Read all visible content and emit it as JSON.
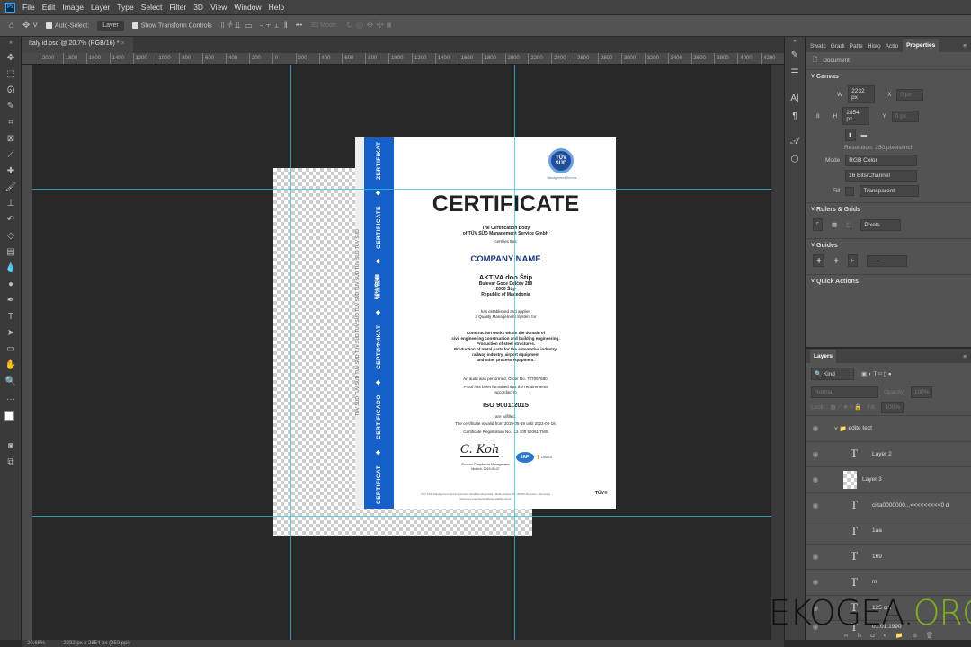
{
  "menu": {
    "logo": "Ps",
    "items": [
      "File",
      "Edit",
      "Image",
      "Layer",
      "Type",
      "Select",
      "Filter",
      "3D",
      "View",
      "Window",
      "Help"
    ]
  },
  "options": {
    "auto_select": "Auto-Select:",
    "layer_select": "Layer",
    "show_transform": "Show Transform Controls",
    "more": "•••",
    "mode_3d": "3D Mode:"
  },
  "doc_tab": {
    "title": "Italy id.psd @ 20.7% (RGB/16) *",
    "close": "×"
  },
  "ruler": [
    "2000",
    "1800",
    "1600",
    "1400",
    "1200",
    "1000",
    "800",
    "600",
    "400",
    "200",
    "0",
    "200",
    "400",
    "600",
    "800",
    "1000",
    "1200",
    "1400",
    "1600",
    "1800",
    "2000",
    "2200",
    "2400",
    "2600",
    "2800",
    "3000",
    "3200",
    "3400",
    "3600",
    "3800",
    "4000",
    "4200"
  ],
  "certificate": {
    "strip": [
      "CERTIFICAT",
      "◆",
      "CERTIFICADO",
      "◆",
      "СЕРТИФИКАТ",
      "◆",
      "認証證書",
      "◆",
      "CERTIFICATE",
      "◆",
      "ZERTIFIKAT"
    ],
    "edge": "TÜV SÜD  TÜV SÜD  TÜV SÜD  TÜV SÜD  TÜV SÜD  TÜV SÜD  TÜV SÜD  TÜV SÜD  TÜV SÜD",
    "logo": "TÜV SÜD",
    "logo_sub": "Management Service",
    "title": "CERTIFICATE",
    "body1": "The Certification Body",
    "body2": "of TÜV SÜD Management Service GmbH",
    "certifies": "certifies that",
    "company_name": "COMPANY NAME",
    "company": "AKTIVA doo Štip",
    "addr1": "Bulevar Goce Delčev 289",
    "addr2": "2000 Štip",
    "addr3": "Republic of Macedonia",
    "est1": "has established and applies",
    "est2": "a Quality Management System for",
    "scope": [
      "Construction works within the domain of",
      "civil engineering construction and building engineering.",
      "Production of steel structures.",
      "Production of metal parts for the automotive industry,",
      "railway industry, airport equipment",
      "and other process equipment."
    ],
    "audit": "An audit was performed, Order No. 707057680.",
    "proof1": "Proof has been furnished that the requirements",
    "proof2": "according to",
    "standard": "ISO 9001:2015",
    "fulfilled": "are fulfilled.",
    "valid": "The certificate is valid from 2019-05-19 until 2022-05-18.",
    "reg": "Certificate Registration No.: 12 100 52061 TMS",
    "signature": "C. Koh",
    "sig1": "Product Compliance Management",
    "sig2": "Munich, 2019-05-07",
    "iaf": "IAF",
    "dakks": "DAkkS",
    "footer1": "TÜV SÜD Management Service GmbH • Zertifizierungsstelle • Ridlerstrasse 65 • 80339 München • Germany",
    "footer2": "www.tuev-sued.de/certificate-validity-check",
    "footer_logo": "TÜV®"
  },
  "right_icons": [
    "brush-settings",
    "adjust",
    "character",
    "paragraph",
    "glyphs",
    "3d"
  ],
  "properties": {
    "tabs": [
      "Swatc",
      "Gradi",
      "Patte",
      "Histo",
      "Actio",
      "Properties"
    ],
    "document": "Document",
    "canvas": "Canvas",
    "w_label": "W",
    "w": "2232 px",
    "h_label": "H",
    "h": "2854 px",
    "x_label": "X",
    "x": "0 px",
    "y_label": "Y",
    "y": "0 px",
    "resolution": "Resolution: 250 pixels/inch",
    "mode_label": "Mode",
    "mode": "RGB Color",
    "depth": "16 Bits/Channel",
    "fill_label": "Fill",
    "fill": "Transparent",
    "rulers": "Rulers & Grids",
    "units": "Pixels",
    "guides": "Guides",
    "quick": "Quick Actions"
  },
  "layers": {
    "tab": "Layers",
    "kind": "Kind",
    "blend": "Normal",
    "opacity_label": "Opacity:",
    "opacity": "100%",
    "lock": "Lock:",
    "fill_label": "Fill:",
    "fill": "100%",
    "items": [
      {
        "name": "edite text",
        "type": "group"
      },
      {
        "name": "Layer 2",
        "type": "text"
      },
      {
        "name": "Layer 3",
        "type": "image"
      },
      {
        "name": "cilta0000000...<<<<<<<<<0 d",
        "type": "text"
      },
      {
        "name": "1aa",
        "type": "text",
        "hidden": true
      },
      {
        "name": "169",
        "type": "text"
      },
      {
        "name": "m",
        "type": "text"
      },
      {
        "name": "125 cm",
        "type": "text"
      },
      {
        "name": "01.01.1990",
        "type": "text"
      }
    ]
  },
  "status": {
    "zoom": "20.66%",
    "size": "2232 px x 2854 px (250 ppi)"
  },
  "watermark": {
    "part1": "EKOGEA.",
    "part2": "ORG",
    "color1": "#111111",
    "color2": "#7fae1e"
  }
}
